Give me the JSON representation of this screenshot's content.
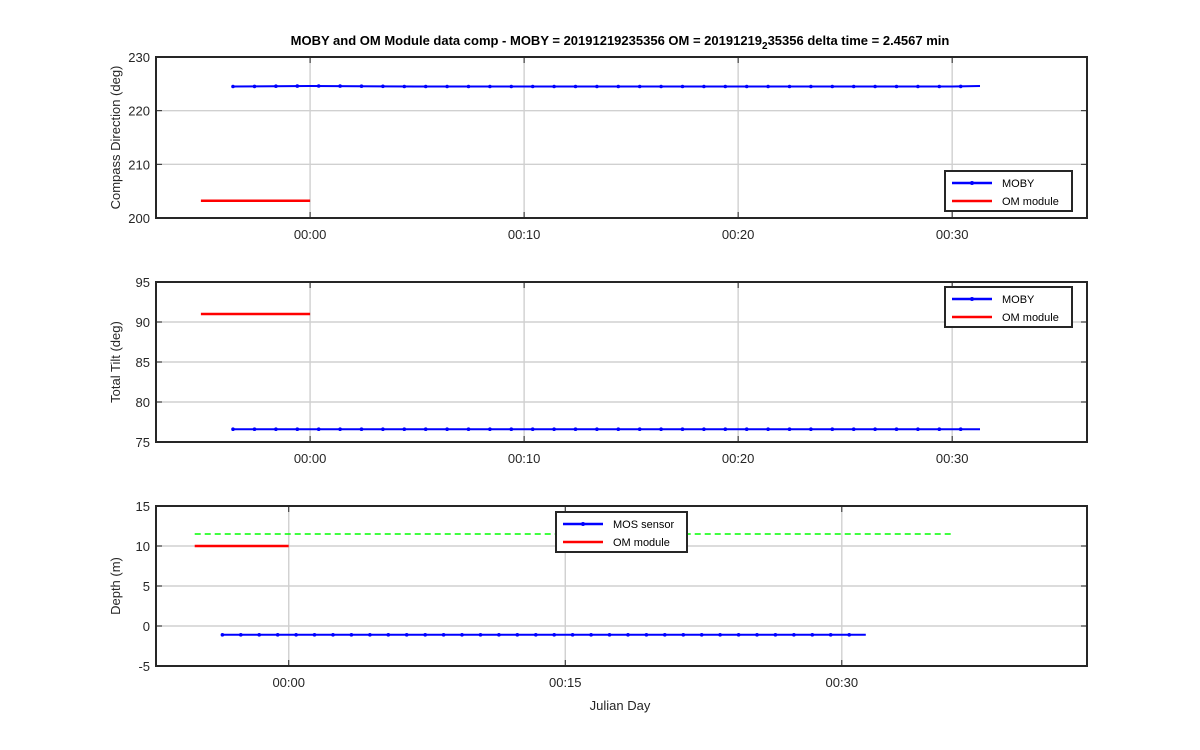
{
  "chart_data": {
    "title": "MOBY and OM Module data comp - MOBY = 20191219235356 OM = 20191219",
    "title_subscript": "2",
    "title_tail": "35356 delta time = 2.4567 min",
    "xlabel": "Julian Day",
    "background": "#ffffff",
    "grid": true,
    "colors": {
      "blue": "#0000ff",
      "red": "#ff0000",
      "green": "#00ff00",
      "grid": "#d0d0d0",
      "axis": "#262626"
    },
    "subplots": [
      {
        "type": "line",
        "ylabel": "Compass Direction (deg)",
        "xlim": [
          -7.2,
          36.3
        ],
        "ylim": [
          200,
          230
        ],
        "xticks": [
          0,
          10,
          20,
          30
        ],
        "xticklabels": [
          "00:00",
          "00:10",
          "00:20",
          "00:30"
        ],
        "yticks": [
          200,
          210,
          220,
          230
        ],
        "legend": {
          "position": "bottom-right",
          "entries": [
            "MOBY",
            "OM module"
          ]
        },
        "series": [
          {
            "name": "MOBY",
            "color": "#0000ff",
            "marker": true,
            "x": [
              -3.6,
              0,
              5,
              10,
              15,
              20,
              25,
              30,
              31.3
            ],
            "y": [
              224.5,
              224.6,
              224.5,
              224.5,
              224.5,
              224.5,
              224.5,
              224.5,
              224.6
            ]
          },
          {
            "name": "OM module",
            "color": "#ff0000",
            "marker": false,
            "x": [
              -5.1,
              0
            ],
            "y": [
              203.2,
              203.2
            ]
          }
        ]
      },
      {
        "type": "line",
        "ylabel": "Total Tilt (deg)",
        "xlim": [
          -7.2,
          36.3
        ],
        "ylim": [
          75,
          95
        ],
        "xticks": [
          0,
          10,
          20,
          30
        ],
        "xticklabels": [
          "00:00",
          "00:10",
          "00:20",
          "00:30"
        ],
        "yticks": [
          75,
          80,
          85,
          90,
          95
        ],
        "legend": {
          "position": "top-right",
          "entries": [
            "MOBY",
            "OM module"
          ]
        },
        "series": [
          {
            "name": "MOBY",
            "color": "#0000ff",
            "marker": true,
            "x": [
              -3.6,
              0,
              5,
              10,
              15,
              20,
              25,
              30,
              31.3
            ],
            "y": [
              76.6,
              76.6,
              76.6,
              76.6,
              76.6,
              76.6,
              76.6,
              76.6,
              76.6
            ]
          },
          {
            "name": "OM module",
            "color": "#ff0000",
            "marker": false,
            "x": [
              -5.1,
              0
            ],
            "y": [
              91.0,
              91.0
            ]
          }
        ]
      },
      {
        "type": "line",
        "ylabel": "Depth (m)",
        "xlim": [
          -7.2,
          43.3
        ],
        "ylim": [
          -5,
          15
        ],
        "xticks": [
          0,
          15,
          30
        ],
        "xticklabels": [
          "00:00",
          "00:15",
          "00:30"
        ],
        "yticks": [
          -5,
          0,
          5,
          10,
          15
        ],
        "legend": {
          "position": "top-center",
          "entries": [
            "MOS sensor",
            "OM module"
          ]
        },
        "reference_line": {
          "y": 11.5,
          "color": "#00ff00",
          "style": "dashed",
          "x": [
            -5.1,
            36
          ]
        },
        "series": [
          {
            "name": "MOS sensor",
            "color": "#0000ff",
            "marker": true,
            "x": [
              -3.6,
              0,
              5,
              10,
              15,
              20,
              25,
              30,
              31.3
            ],
            "y": [
              -1.1,
              -1.1,
              -1.1,
              -1.1,
              -1.1,
              -1.1,
              -1.1,
              -1.1,
              -1.1
            ]
          },
          {
            "name": "OM module",
            "color": "#ff0000",
            "marker": false,
            "x": [
              -5.1,
              0
            ],
            "y": [
              10.0,
              10.0
            ]
          }
        ]
      }
    ]
  }
}
